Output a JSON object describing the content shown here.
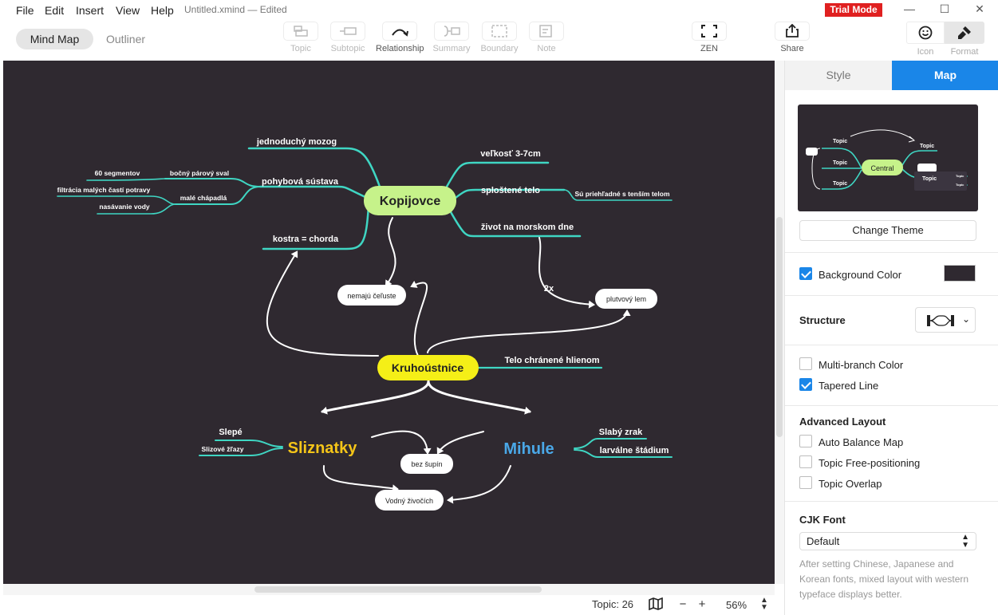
{
  "menu": [
    "File",
    "Edit",
    "Insert",
    "View",
    "Help"
  ],
  "document_title": "Untitled.xmind — Edited",
  "trial_badge": "Trial Mode",
  "view_tabs": {
    "mind_map": "Mind Map",
    "outliner": "Outliner"
  },
  "toolbar": {
    "topic": "Topic",
    "subtopic": "Subtopic",
    "relationship": "Relationship",
    "summary": "Summary",
    "boundary": "Boundary",
    "note": "Note",
    "zen": "ZEN",
    "share": "Share",
    "icon": "Icon",
    "format": "Format"
  },
  "status": {
    "topic_count": "Topic: 26",
    "zoom": "56%"
  },
  "panel": {
    "tabs": {
      "style": "Style",
      "map": "Map"
    },
    "preview": {
      "central": "Central",
      "topic": "Topic"
    },
    "change_theme": "Change Theme",
    "background_color": {
      "label": "Background Color",
      "checked": true,
      "color": "#2f2930"
    },
    "structure": "Structure",
    "multi_branch": {
      "label": "Multi-branch Color",
      "checked": false
    },
    "tapered_line": {
      "label": "Tapered Line",
      "checked": true
    },
    "advanced_layout": "Advanced Layout",
    "auto_balance": {
      "label": "Auto Balance Map",
      "checked": false
    },
    "free_positioning": {
      "label": "Topic Free-positioning",
      "checked": false
    },
    "overlap": {
      "label": "Topic Overlap",
      "checked": false
    },
    "cjk_font": "CJK Font",
    "cjk_value": "Default",
    "cjk_note": "After setting Chinese, Japanese and Korean fonts, mixed layout with western typeface displays better."
  },
  "colors": {
    "canvas_bg": "#2f2930",
    "branch_line": "#3fd6c3",
    "kopijovce_fill": "#c6f28a",
    "kruhoustnice_fill": "#f5ef17",
    "sliznatky_text": "#f5c518",
    "mihule_text": "#4aa8e8",
    "accent": "#1a86e8"
  },
  "mindmap": {
    "kopijovce": "Kopijovce",
    "kruhoustnice": "Kruhoústnice",
    "sliznatky": "Sliznatky",
    "mihule": "Mihule",
    "k_left": {
      "mozog": "jednoduchý mozog",
      "sustava": "pohybová sústava",
      "svaly": "bočný párový sval",
      "segmenty": "60 segmentov",
      "chapadla": "malé chápadlá",
      "filtracia": "filtrácia malých častí potravy",
      "nasavanie": "nasávanie vody",
      "kostra": "kostra = chorda"
    },
    "k_right": {
      "velkost": "veľkosť 3-7cm",
      "sploštene": "sploštené telo",
      "priehladne": "Sú priehľadné s tenším telom",
      "zivot": "život na morskom dne"
    },
    "kr_right": "Telo chránené hlienom",
    "s_left": {
      "slepe": "Slepé",
      "zlazy": "Slizové žľazy"
    },
    "m_right": {
      "zrak": "Slabý zrak",
      "stadium": "larválne štádium"
    },
    "floating": {
      "celuste": "nemajú čeľuste",
      "plutvovy": "plutvový lem",
      "bez_supin": "bez šupín",
      "vodny": "Vodný živočích"
    },
    "rel_label": "2x"
  }
}
